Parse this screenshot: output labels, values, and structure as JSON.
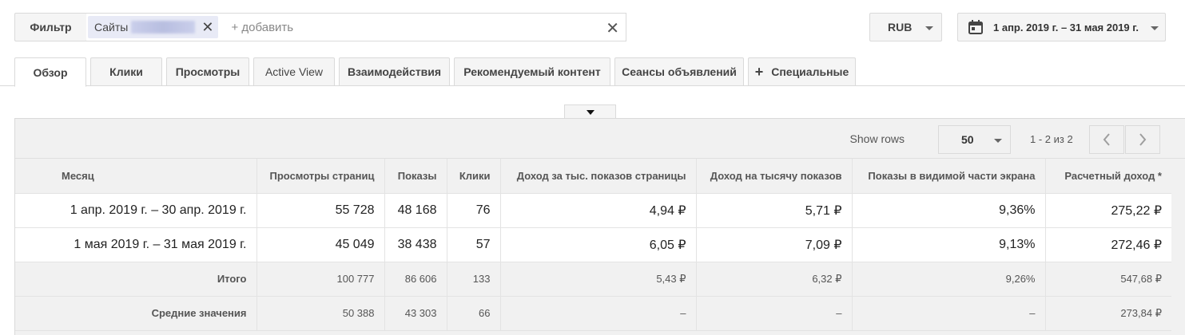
{
  "filter": {
    "button_label": "Фильтр",
    "chip_label": "Сайты",
    "add_placeholder": "+ добавить"
  },
  "currency": {
    "value": "RUB"
  },
  "date_range": {
    "label": "1 апр. 2019 г. – 31 мая 2019 г."
  },
  "tabs": [
    {
      "label": "Обзор",
      "active": true
    },
    {
      "label": "Клики"
    },
    {
      "label": "Просмотры"
    },
    {
      "label": "Active View"
    },
    {
      "label": "Взаимодействия"
    },
    {
      "label": "Рекомендуемый контент"
    },
    {
      "label": "Сеансы объявлений"
    },
    {
      "label": "Специальные"
    }
  ],
  "pager": {
    "show_rows_label": "Show rows",
    "rows_value": "50",
    "range_text": "1 - 2 из 2"
  },
  "table": {
    "columns": [
      "Месяц",
      "Просмотры страниц",
      "Показы",
      "Клики",
      "Доход за тыс. показов страницы",
      "Доход на тысячу показов",
      "Показы в видимой части экрана",
      "Расчетный доход *"
    ],
    "rows": [
      [
        "1 апр. 2019 г. – 30 апр. 2019 г.",
        "55 728",
        "48 168",
        "76",
        "4,94 ₽",
        "5,71 ₽",
        "9,36%",
        "275,22 ₽"
      ],
      [
        "1 мая 2019 г. – 31 мая 2019 г.",
        "45 049",
        "38 438",
        "57",
        "6,05 ₽",
        "7,09 ₽",
        "9,13%",
        "272,46 ₽"
      ]
    ],
    "total": [
      "Итого",
      "100 777",
      "86 606",
      "133",
      "5,43 ₽",
      "6,32 ₽",
      "9,26%",
      "547,68 ₽"
    ],
    "average": [
      "Средние значения",
      "50 388",
      "43 303",
      "66",
      "–",
      "–",
      "–",
      "273,84 ₽"
    ]
  }
}
